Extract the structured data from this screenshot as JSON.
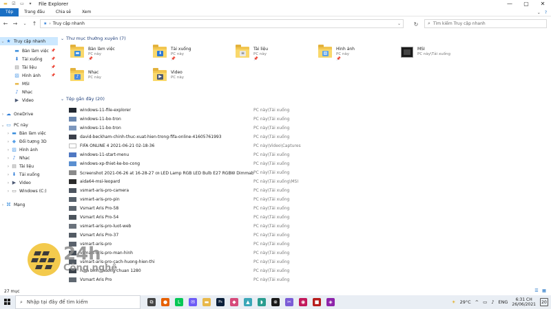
{
  "window": {
    "title": "File Explorer",
    "controls": [
      "—",
      "▢",
      "✕"
    ]
  },
  "ribbon": {
    "tabs": [
      "Tệp",
      "Trang đầu",
      "Chia sẻ",
      "Xem"
    ],
    "active_tab": "Tệp"
  },
  "nav": {
    "breadcrumb": "Truy cập nhanh",
    "search_placeholder": "Tìm kiếm Truy cập nhanh"
  },
  "sidebar": {
    "items": [
      {
        "label": "Truy cập nhanh",
        "icon": "star-icon",
        "pinned": false
      },
      {
        "label": "Bàn làm việc",
        "icon": "desktop-icon",
        "pinned": true
      },
      {
        "label": "Tải xuống",
        "icon": "download-icon",
        "pinned": true
      },
      {
        "label": "Tài liệu",
        "icon": "document-icon",
        "pinned": true
      },
      {
        "label": "Hình ảnh",
        "icon": "picture-icon",
        "pinned": true
      },
      {
        "label": "MSI",
        "icon": "folder-icon",
        "pinned": false
      },
      {
        "label": "Nhạc",
        "icon": "music-icon",
        "pinned": false
      },
      {
        "label": "Video",
        "icon": "video-icon",
        "pinned": false
      },
      {
        "label": "OneDrive",
        "icon": "cloud-icon",
        "pinned": false
      },
      {
        "label": "PC này",
        "icon": "pc-icon",
        "pinned": false
      },
      {
        "label": "Bàn làm việc",
        "icon": "desktop-icon",
        "pinned": false
      },
      {
        "label": "Đối tượng 3D",
        "icon": "cube-icon",
        "pinned": false
      },
      {
        "label": "Hình ảnh",
        "icon": "picture-icon",
        "pinned": false
      },
      {
        "label": "Nhạc",
        "icon": "music-icon",
        "pinned": false
      },
      {
        "label": "Tài liệu",
        "icon": "document-icon",
        "pinned": false
      },
      {
        "label": "Tải xuống",
        "icon": "download-icon",
        "pinned": false
      },
      {
        "label": "Video",
        "icon": "video-icon",
        "pinned": false
      },
      {
        "label": "Windows (C:)",
        "icon": "drive-icon",
        "pinned": false
      },
      {
        "label": "Mạng",
        "icon": "network-icon",
        "pinned": false
      }
    ]
  },
  "frequent": {
    "header": "Thư mục thường xuyên (7)",
    "folders": [
      {
        "name": "Bàn làm việc",
        "location": "PC này",
        "pin": "📌",
        "icon": "desktop-folder-icon"
      },
      {
        "name": "Tải xuống",
        "location": "PC này",
        "pin": "📌",
        "icon": "download-folder-icon"
      },
      {
        "name": "Tài liệu",
        "location": "PC này",
        "pin": "📌",
        "icon": "document-folder-icon"
      },
      {
        "name": "Hình ảnh",
        "location": "PC này",
        "pin": "📌",
        "icon": "picture-folder-icon"
      },
      {
        "name": "MSI",
        "location": "PC này\\Tải xuống",
        "pin": "",
        "icon": "msi-folder-icon"
      },
      {
        "name": "Nhạc",
        "location": "PC này",
        "pin": "",
        "icon": "music-folder-icon"
      },
      {
        "name": "Video",
        "location": "PC này",
        "pin": "",
        "icon": "video-folder-icon"
      }
    ]
  },
  "recent": {
    "header": "Tệp gần đây (20)",
    "files": [
      {
        "name": "windows-11-file-explorer",
        "location": "PC này\\Tải xuống",
        "thumb": "#222831"
      },
      {
        "name": "windows-11-bo-tron",
        "location": "PC này\\Tải xuống",
        "thumb": "#6b88b0"
      },
      {
        "name": "windows-11-bo-tron",
        "location": "PC này\\Tải xuống",
        "thumb": "#7d97bd"
      },
      {
        "name": "david-beckham-chinh-thuc-xuat-hien-trong-fifa-online-41605761993",
        "location": "PC này\\Tải xuống",
        "thumb": "#3a3f4a"
      },
      {
        "name": "FIFA ONLINE 4 2021-06-21 02-18-36",
        "location": "PC này\\Video\\Captures",
        "thumb": "#ffffff"
      },
      {
        "name": "windows-11-start-menu",
        "location": "PC này\\Tải xuống",
        "thumb": "#4f78c2"
      },
      {
        "name": "windows-xp-thiet-ke-bo-cong",
        "location": "PC này\\Tải xuống",
        "thumb": "#5a8fd0"
      },
      {
        "name": "Screenshot 2021-06-26 at 16-28-27 ㎝ LED Lamp RGB LED Bulb E27 RGBW Dimmabl...",
        "location": "PC này\\Tải xuống",
        "thumb": "#8a8a8a"
      },
      {
        "name": "aida64-msi-leopard",
        "location": "PC này\\Tải xuống\\MSI",
        "thumb": "#2b2b2b"
      },
      {
        "name": "vsmart-aris-pro-camera",
        "location": "PC này\\Tải xuống",
        "thumb": "#4d5560"
      },
      {
        "name": "vsmart-aris-pro-pin",
        "location": "PC này\\Tải xuống",
        "thumb": "#56606b"
      },
      {
        "name": "Vsmart Aris Pro-58",
        "location": "PC này\\Tải xuống",
        "thumb": "#5d6670"
      },
      {
        "name": "Vsmart Aris Pro-54",
        "location": "PC này\\Tải xuống",
        "thumb": "#4b535c"
      },
      {
        "name": "vsmart-aris-pro-luot-web",
        "location": "PC này\\Tải xuống",
        "thumb": "#6a727c"
      },
      {
        "name": "Vsmart Aris Pro-37",
        "location": "PC này\\Tải xuống",
        "thumb": "#535b64"
      },
      {
        "name": "vsmart-aris-pro",
        "location": "PC này\\Tải xuống",
        "thumb": "#5a626c"
      },
      {
        "name": "vsmart-aris-pro-man-hinh",
        "location": "PC này\\Tải xuống",
        "thumb": "#474f58"
      },
      {
        "name": "vsmart-aris-pro-cach-huong-hien-thi",
        "location": "PC này\\Tải xuống",
        "thumb": "#525a63"
      },
      {
        "name": "hinh binh thuong chuan 1280",
        "location": "PC này\\Tải xuống",
        "thumb": "#3d444c"
      },
      {
        "name": "Vsmart Aris Pro",
        "location": "PC này\\Tải xuống",
        "thumb": "#606871"
      }
    ]
  },
  "status": {
    "item_count": "27 mục"
  },
  "taskbar": {
    "search_placeholder": "Nhập tại đây để tìm kiếm",
    "apps": [
      {
        "name": "task-view-icon",
        "glyph": "⧉",
        "color": "#444444"
      },
      {
        "name": "firefox-icon",
        "glyph": "●",
        "color": "#e66000"
      },
      {
        "name": "line-icon",
        "glyph": "L",
        "color": "#06c755"
      },
      {
        "name": "messenger-icon",
        "glyph": "✉",
        "color": "#6d5cf6"
      },
      {
        "name": "file-explorer-icon",
        "glyph": "▬",
        "color": "#e8b84a"
      },
      {
        "name": "photoshop-icon",
        "glyph": "Ps",
        "color": "#0b1f3a"
      },
      {
        "name": "nox-icon",
        "glyph": "◆",
        "color": "#d64a7a"
      },
      {
        "name": "image-app-icon",
        "glyph": "▲",
        "color": "#3aa7b8"
      },
      {
        "name": "chat-app-icon",
        "glyph": "◗",
        "color": "#2a9d8f"
      },
      {
        "name": "xbox-icon",
        "glyph": "⊗",
        "color": "#1a1a1a"
      },
      {
        "name": "snip-icon",
        "glyph": "✂",
        "color": "#7b5cd6"
      },
      {
        "name": "photos-icon",
        "glyph": "◉",
        "color": "#c2185b"
      },
      {
        "name": "screen-record-icon",
        "glyph": "■",
        "color": "#b71c1c"
      },
      {
        "name": "media-app-icon",
        "glyph": "◈",
        "color": "#8e24aa"
      }
    ],
    "weather": "29°C",
    "language": "ENG",
    "time": "6:31 CH",
    "date": "26/06/2021",
    "notifications": "20"
  },
  "watermark": {
    "brand_number": "24h",
    "brand_text": "Công nghệ"
  }
}
